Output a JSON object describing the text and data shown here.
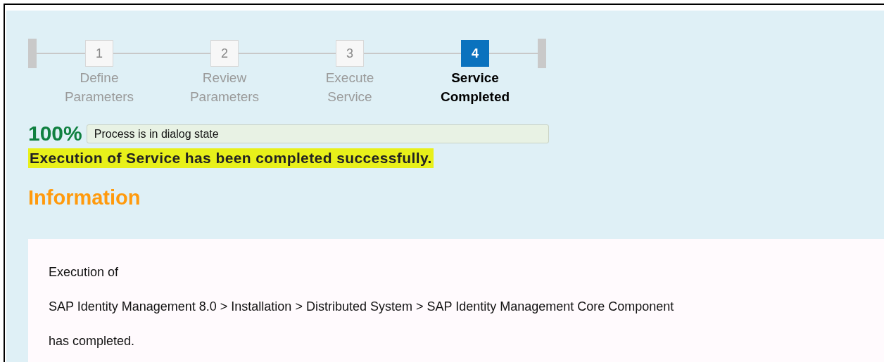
{
  "steps": [
    {
      "number": "1",
      "label": "Define Parameters",
      "selected": false
    },
    {
      "number": "2",
      "label": "Review Parameters",
      "selected": false
    },
    {
      "number": "3",
      "label": "Execute Service",
      "selected": false
    },
    {
      "number": "4",
      "label": "Service Completed",
      "selected": true
    }
  ],
  "progress": {
    "percent": "100%",
    "status": "Process is in dialog state"
  },
  "message": {
    "text": "Execution of Service has been completed successfully.",
    "highlighted": true
  },
  "section_title": "Information",
  "info_lines": [
    "Execution of",
    "SAP Identity Management 8.0 > Installation > Distributed System > SAP Identity Management Core Component",
    "has completed."
  ]
}
